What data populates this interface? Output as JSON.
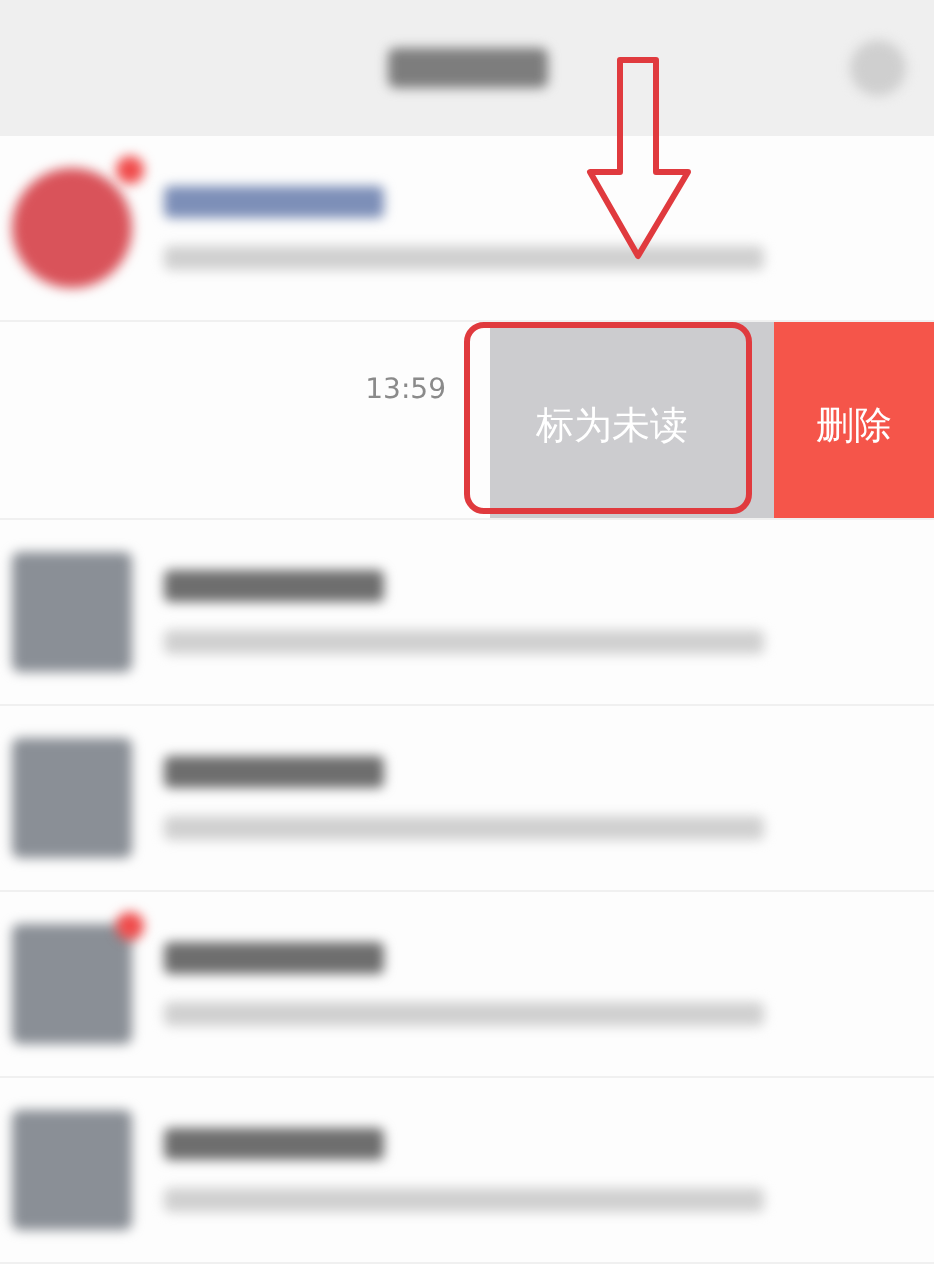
{
  "swiped_row": {
    "time": "13:59",
    "actions": [
      {
        "kind": "mark",
        "label": "标为未读"
      },
      {
        "kind": "delete",
        "label": "删除"
      }
    ]
  },
  "rows": [
    {
      "kind": "round",
      "badge": true
    },
    {
      "kind": "square",
      "badge": false
    },
    {
      "kind": "square",
      "badge": false
    },
    {
      "kind": "square",
      "badge": true
    },
    {
      "kind": "square",
      "badge": false
    }
  ]
}
